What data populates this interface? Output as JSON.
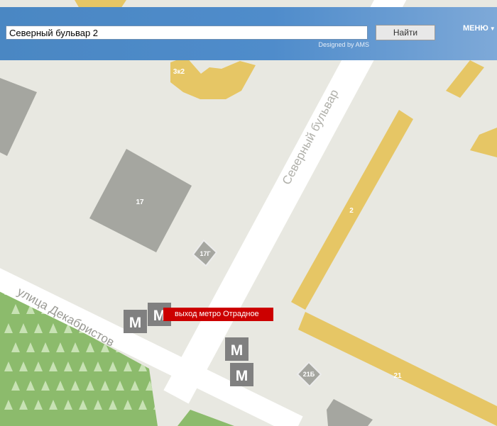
{
  "search": {
    "value": "Северный бульвар 2"
  },
  "header": {
    "search_button_label": "Найти",
    "credit": "Designed by AMS",
    "menu_label": "МЕНЮ",
    "menu_icon": "chevron-down-icon"
  },
  "map": {
    "streets": [
      "Северный бульвар",
      "улица Декабристов"
    ],
    "building_labels": [
      "3к2",
      "17",
      "17Г",
      "2",
      "21Б",
      "21"
    ],
    "metro_letter": "M",
    "metro_label": "выход метро Отрадное",
    "colors": {
      "background": "#e8e8e1",
      "road": "#ffffff",
      "residential": "#e6c665",
      "building_gray": "#a5a6a0",
      "park": "#8cbb6c",
      "tree": "#c8e2b4",
      "metro_marker": "#808080",
      "metro_label": "#cc0000",
      "header": "#4f8ccb"
    }
  }
}
